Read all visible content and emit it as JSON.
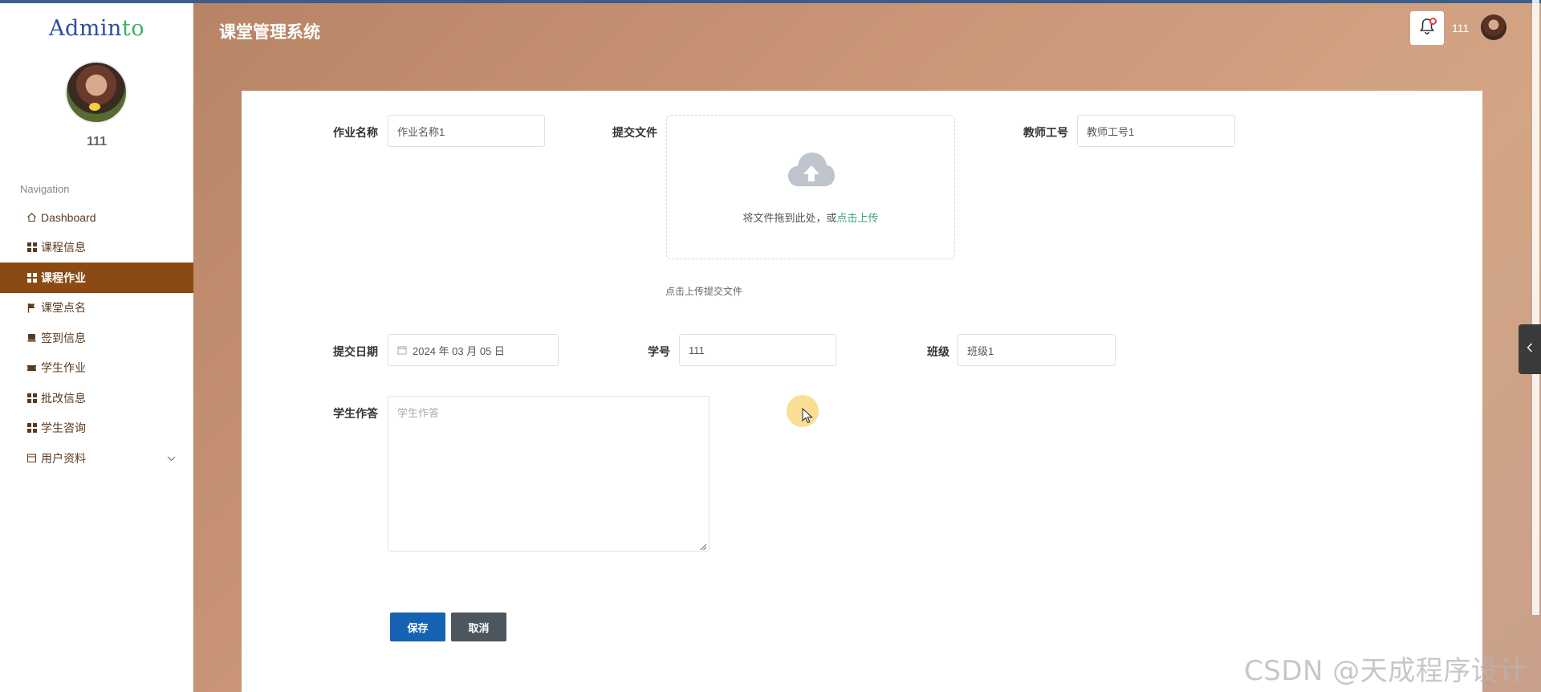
{
  "app": {
    "logo_main": "Admin",
    "logo_accent": "to",
    "title": "课堂管理系统"
  },
  "sidebar": {
    "username": "111",
    "nav_heading": "Navigation",
    "items": [
      {
        "label": "Dashboard",
        "icon": "home-icon"
      },
      {
        "label": "课程信息",
        "icon": "grid-icon"
      },
      {
        "label": "课程作业",
        "icon": "grid-icon",
        "active": true
      },
      {
        "label": "课堂点名",
        "icon": "flag-icon"
      },
      {
        "label": "签到信息",
        "icon": "inbox-icon"
      },
      {
        "label": "学生作业",
        "icon": "ticket-icon"
      },
      {
        "label": "批改信息",
        "icon": "grid-icon"
      },
      {
        "label": "学生咨询",
        "icon": "grid-icon"
      },
      {
        "label": "用户资料",
        "icon": "calendar-icon",
        "has_submenu": true
      }
    ]
  },
  "header": {
    "username": "111",
    "notification_icon": "bell-icon"
  },
  "form": {
    "homework_name": {
      "label": "作业名称",
      "value": "作业名称1"
    },
    "submit_file": {
      "label": "提交文件",
      "drop_text": "将文件拖到此处，或",
      "click_text": "点击上传",
      "hint": "点击上传提交文件"
    },
    "teacher_id": {
      "label": "教师工号",
      "value": "教师工号1"
    },
    "submit_date": {
      "label": "提交日期",
      "value": "2024 年 03 月 05 日"
    },
    "student_no": {
      "label": "学号",
      "value": "111"
    },
    "class": {
      "label": "班级",
      "value": "班级1"
    },
    "student_answer": {
      "label": "学生作答",
      "placeholder": "学生作答"
    },
    "save_label": "保存",
    "cancel_label": "取消"
  },
  "watermark": "CSDN @天成程序设计",
  "colors": {
    "active_nav": "#8b4a14",
    "save_button": "#1763b3",
    "cancel_button": "#4d555e",
    "link": "#3aa57a"
  }
}
